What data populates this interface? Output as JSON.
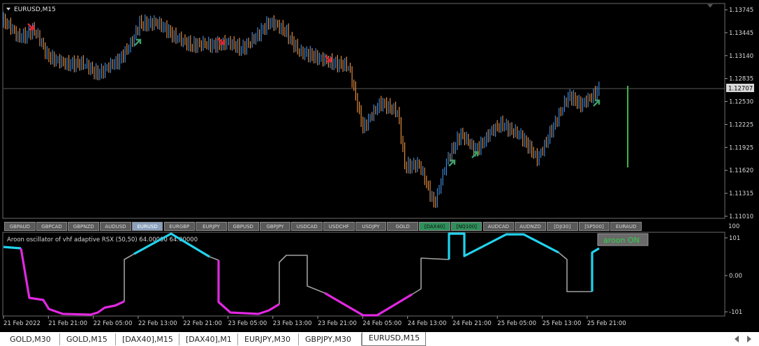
{
  "chart": {
    "title": "EURUSD,M15",
    "current_price": "1.12707",
    "price_ticks": [
      "1.13745",
      "1.13445",
      "1.13140",
      "1.12835",
      "1.12530",
      "1.12225",
      "1.11925",
      "1.11620",
      "1.11315",
      "1.11010"
    ],
    "time_ticks": [
      "21 Feb 2022",
      "21 Feb 21:00",
      "22 Feb 05:00",
      "22 Feb 13:00",
      "22 Feb 21:00",
      "23 Feb 05:00",
      "23 Feb 13:00",
      "23 Feb 21:00",
      "24 Feb 05:00",
      "24 Feb 13:00",
      "24 Feb 21:00",
      "25 Feb 05:00",
      "25 Feb 13:00",
      "25 Feb 21:00"
    ],
    "colors": {
      "bull": "#3d86d6",
      "bear": "#e08a3c",
      "up_arrow": "#3ca06a",
      "down_arrow": "#d62839",
      "bg": "#000000",
      "grid": "#404040"
    }
  },
  "symbol_bar": [
    {
      "label": "GBPAUD",
      "state": "normal"
    },
    {
      "label": "GBPCAD",
      "state": "normal"
    },
    {
      "label": "GBPNZD",
      "state": "normal"
    },
    {
      "label": "AUDUSD",
      "state": "normal"
    },
    {
      "label": "EURUSD",
      "state": "selected"
    },
    {
      "label": "EURGBP",
      "state": "normal"
    },
    {
      "label": "EURJPY",
      "state": "normal"
    },
    {
      "label": "GBPUSD",
      "state": "normal"
    },
    {
      "label": "GBPJPY",
      "state": "normal"
    },
    {
      "label": "USDCAD",
      "state": "normal"
    },
    {
      "label": "USDCHF",
      "state": "normal"
    },
    {
      "label": "USDJPY",
      "state": "normal"
    },
    {
      "label": "GOLD",
      "state": "normal"
    },
    {
      "label": "[DAX40]",
      "state": "highlight"
    },
    {
      "label": "[NQ100]",
      "state": "highlight"
    },
    {
      "label": "AUDCAD",
      "state": "normal"
    },
    {
      "label": "AUDNZD",
      "state": "normal"
    },
    {
      "label": "[DJI30]",
      "state": "normal"
    },
    {
      "label": "[SP500]",
      "state": "normal"
    },
    {
      "label": "EURAUD",
      "state": "normal"
    }
  ],
  "indicator": {
    "label": "Aroon oscillator of vhf adaptive RSX (50,50) 64.00000 64.00000",
    "ticks": [
      "101",
      "0.00",
      "-101"
    ],
    "top_label": "100",
    "button_label": "aroon ON",
    "colors": {
      "up": "#22d3ee",
      "down": "#e028e0",
      "neutral": "#a0a0a0"
    }
  },
  "tabs": [
    {
      "label": "GOLD,M30",
      "active": false
    },
    {
      "label": "GOLD,M15",
      "active": false
    },
    {
      "label": "[DAX40],M15",
      "active": false
    },
    {
      "label": "[DAX40],M1",
      "active": false
    },
    {
      "label": "EURJPY,M30",
      "active": false
    },
    {
      "label": "GBPJPY,M30",
      "active": false
    },
    {
      "label": "EURUSD,M15",
      "active": true
    }
  ]
}
